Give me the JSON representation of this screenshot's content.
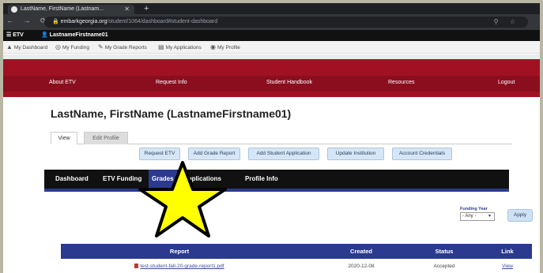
{
  "browser": {
    "tab_title": "LastName, FirstName (Lastnam...",
    "url_host": "embarkgeorgia.org",
    "url_path": "/student/1064/dashboard#student-dashboard"
  },
  "app_header": {
    "product": "ETV",
    "user": "LastnameFirstname01"
  },
  "shortcuts": [
    {
      "label": "My Dashboard",
      "icon": "person-icon"
    },
    {
      "label": "My Funding",
      "icon": "funding-icon"
    },
    {
      "label": "My Grade Reports",
      "icon": "pencil-icon"
    },
    {
      "label": "My Applications",
      "icon": "document-icon"
    },
    {
      "label": "My Profile",
      "icon": "profile-icon"
    }
  ],
  "red_nav": [
    "About ETV",
    "Request Info",
    "Student Handbook",
    "Resources",
    "Logout"
  ],
  "page_title": "LastName, FirstName (LastnameFirstname01)",
  "profile_tabs": [
    "View",
    "Edit Profile"
  ],
  "actions": [
    "Request ETV",
    "Add Grade Report",
    "Add Student Application",
    "Update Institution",
    "Account Credentials"
  ],
  "dark_nav": [
    "Dashboard",
    "ETV Funding",
    "Grades",
    "Applications",
    "Profile Info"
  ],
  "funding_year": {
    "label": "Funding Year",
    "value": "- Any -",
    "apply": "Apply"
  },
  "table": {
    "headers": [
      "Report",
      "Created",
      "Status",
      "Link"
    ],
    "rows": [
      {
        "report": "test-student-fall-20-grade-report1.pdf",
        "created": "2020-12-08",
        "status": "Accepted",
        "link": "View"
      }
    ]
  },
  "colors": {
    "brand_red": "#a01123",
    "nav_blue": "#2b3a8f",
    "star_fill": "#ffff00"
  }
}
